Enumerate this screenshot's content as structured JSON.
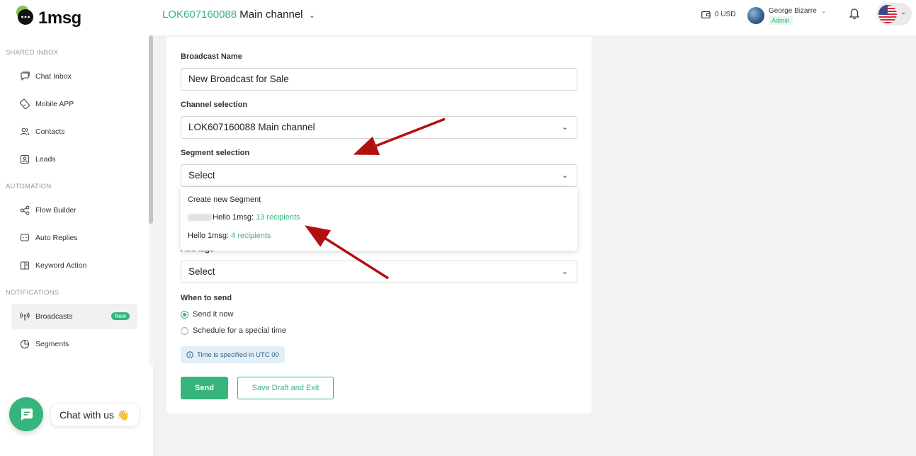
{
  "header": {
    "brand": "1msg",
    "channel_id": "LOK607160088",
    "channel_name": "Main channel",
    "balance": "0 USD",
    "user_name": "George Bizarre",
    "user_role": "Admin",
    "language_flag": "us-flag-icon"
  },
  "sidebar": {
    "sections": [
      {
        "label": "SHARED INBOX",
        "items": [
          {
            "label": "Chat Inbox",
            "icon": "chat-inbox-icon"
          },
          {
            "label": "Mobile APP",
            "icon": "mobile-app-icon"
          },
          {
            "label": "Contacts",
            "icon": "contacts-icon"
          },
          {
            "label": "Leads",
            "icon": "leads-icon"
          }
        ]
      },
      {
        "label": "AUTOMATION",
        "items": [
          {
            "label": "Flow Builder",
            "icon": "flow-builder-icon"
          },
          {
            "label": "Auto Replies",
            "icon": "auto-replies-icon"
          },
          {
            "label": "Keyword Action",
            "icon": "keyword-action-icon"
          }
        ]
      },
      {
        "label": "NOTIFICATIONS",
        "items": [
          {
            "label": "Broadcasts",
            "icon": "broadcast-icon",
            "active": true,
            "badge": "New"
          },
          {
            "label": "Segments",
            "icon": "segments-icon"
          }
        ]
      }
    ]
  },
  "form": {
    "broadcast_name_label": "Broadcast Name",
    "broadcast_name_value": "New Broadcast for Sale",
    "channel_label": "Channel selection",
    "channel_value": "LOK607160088 Main channel",
    "segment_label": "Segment selection",
    "segment_value": "Select",
    "segment_options": [
      {
        "name": "Create new Segment",
        "recipients": ""
      },
      {
        "name": "Hello 1msg:",
        "recipients": "13 recipients"
      },
      {
        "name": "Hello 1msg:",
        "recipients": "4 recipients"
      }
    ],
    "tags_label": "Add tags",
    "tags_value": "Select",
    "when_label": "When to send",
    "send_now_label": "Send it now",
    "schedule_label": "Schedule for a special time",
    "send_now_checked": true,
    "timezone_note": "Time is specified in UTC 00",
    "send_button": "Send",
    "draft_button": "Save Draft and Exit"
  },
  "chat_widget": {
    "label": "Chat with us",
    "emoji": "👋"
  },
  "colors": {
    "accent": "#35b57b",
    "annotation_arrow": "#b0110f"
  }
}
